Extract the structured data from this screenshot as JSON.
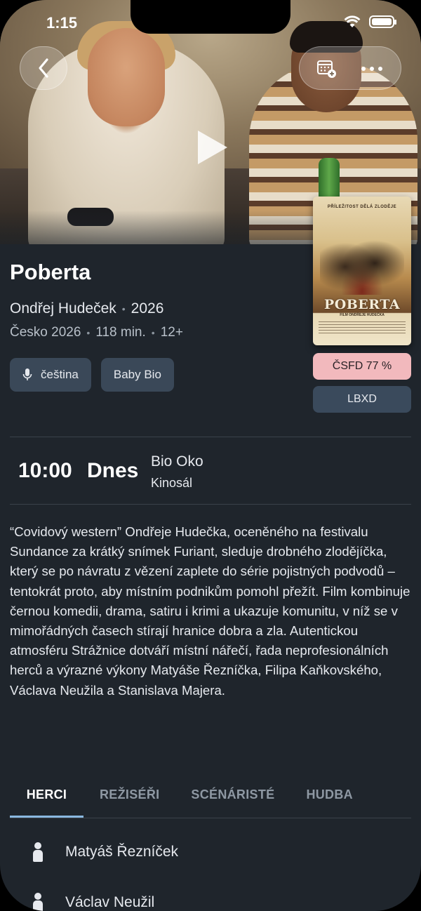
{
  "status_bar": {
    "time": "1:15"
  },
  "movie": {
    "title": "Poberta",
    "director": "Ondřej Hudeček",
    "year": "2026",
    "origin": "Česko 2026",
    "duration": "118 min.",
    "age_rating": "12+",
    "tags": [
      "čeština",
      "Baby Bio"
    ],
    "ratings": {
      "csfd": "ČSFD 77 %",
      "lbxd": "LBXD"
    },
    "poster": {
      "tagline": "PŘÍLEŽITOST DĚLÁ ZLODĚJE",
      "title": "POBERTA",
      "subtitle": "FILM ONDŘEJE HUDEČKA"
    }
  },
  "screening": {
    "time": "10:00",
    "day": "Dnes",
    "cinema": "Bio Oko",
    "hall": "Kinosál"
  },
  "description": "“Covidový western” Ondřeje Hudečka, oceněného na festivalu Sundance za krátký snímek Furiant, sleduje drobného zlodějíčka, který se po návratu z vězení zaplete do série pojistných podvodů – tentokrát proto, aby místním podnikům pomohl přežít. Film kombinuje černou komedii, drama, satiru i krimi a ukazuje komunitu, v níž se v mimořádných časech stírají hranice dobra a zla. Autentickou atmosféru Strážnice dotváří místní nářečí, řada neprofesionálních herců a výrazné výkony Matyáše Řezníčka, Filipa Kaňkovského, Václava Neužila a Stanislava Majera.",
  "tabs": [
    {
      "label": "HERCI",
      "active": true
    },
    {
      "label": "REŽISÉŘI",
      "active": false
    },
    {
      "label": "SCÉNÁRISTÉ",
      "active": false
    },
    {
      "label": "HUDBA",
      "active": false
    }
  ],
  "cast": [
    "Matyáš Řezníček",
    "Václav Neužil"
  ],
  "icons": {
    "back": "chevron-left-icon",
    "calendar_add": "calendar-add-icon",
    "more": "more-horizontal-icon",
    "play": "play-icon",
    "mic": "microphone-icon",
    "person": "person-icon"
  },
  "colors": {
    "background": "#1f252c",
    "chip": "#3a4858",
    "csfd": "#f2b9bd",
    "lbxd": "#3a4a5c",
    "tab_accent": "#8ab8e0"
  }
}
